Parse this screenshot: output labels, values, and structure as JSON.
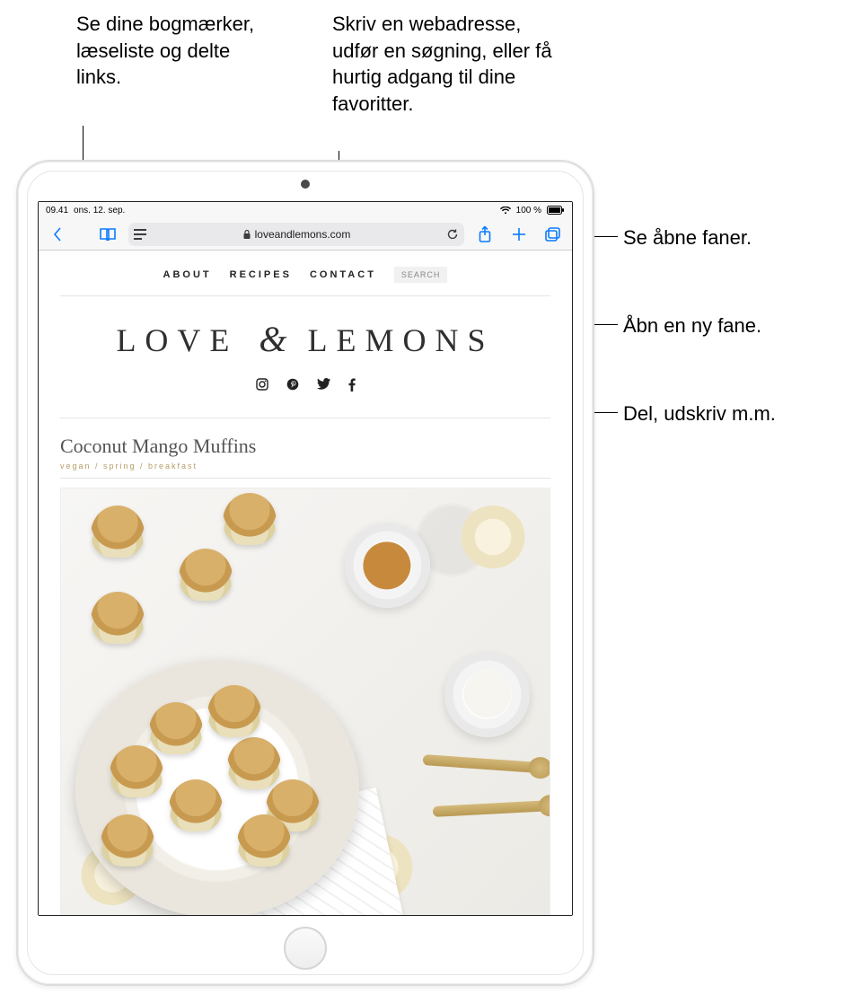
{
  "callouts": {
    "bookmarks": "Se dine bogmærker, læseliste og delte links.",
    "address": "Skriv en webadresse, udfør en søgning, eller få hurtig adgang til dine favoritter.",
    "tabs": "Se åbne faner.",
    "newtab": "Åbn en ny fane.",
    "share": "Del, udskriv m.m."
  },
  "status": {
    "time": "09.41",
    "date": "ons. 12. sep.",
    "battery": "100 %"
  },
  "toolbar": {
    "domain": "loveandlemons.com"
  },
  "site": {
    "nav": {
      "about": "ABOUT",
      "recipes": "RECIPES",
      "contact": "CONTACT",
      "search": "SEARCH"
    },
    "logo_left": "LOVE",
    "logo_amp": "&",
    "logo_right": "LEMONS",
    "post_title": "Coconut Mango Muffins",
    "post_meta": "vegan / spring / breakfast"
  }
}
